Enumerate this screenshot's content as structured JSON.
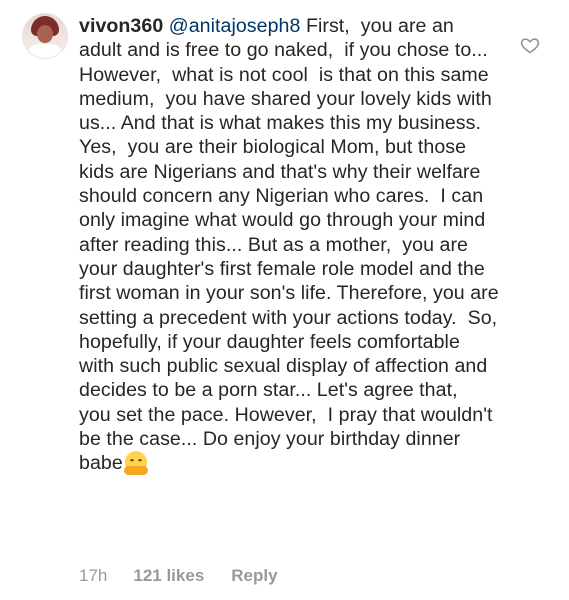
{
  "comment": {
    "username": "vivon360",
    "mention": "@anitajoseph8",
    "text": "First,  you are an adult and is free to go naked,  if you chose to... However,  what is not cool  is that on this same medium,  you have shared your lovely kids with us... And that is what makes this my business.  Yes,  you are their biological Mom, but those kids are Nigerians and that's why their welfare should concern any Nigerian who cares.  I can only imagine what would go through your mind after reading this... But as a mother,  you are your daughter's first female role model and the first woman in your son's life. Therefore, you are setting a precedent with your actions today.  So,  hopefully, if your daughter feels comfortable with such public sexual display of affection and decides to be a porn star... Let's agree that,  you set the pace. However,  I pray that wouldn't be the case... Do enjoy your birthday dinner babe",
    "emoji": "hugging-face-emoji"
  },
  "meta": {
    "time": "17h",
    "likes": "121 likes",
    "reply": "Reply"
  },
  "icons": {
    "like": "heart-outline-icon",
    "avatar": "user-avatar"
  },
  "colors": {
    "text": "#262626",
    "mention": "#003569",
    "meta": "#999999"
  }
}
